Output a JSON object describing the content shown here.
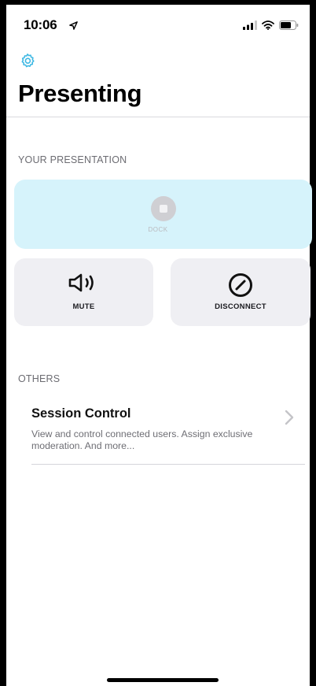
{
  "status_bar": {
    "time": "10:06",
    "location_icon": "location-arrow-icon",
    "signal_icon": "cellular-signal-icon",
    "wifi_icon": "wifi-icon",
    "battery_icon": "battery-icon"
  },
  "header": {
    "settings_icon": "gear-icon",
    "title": "Presenting"
  },
  "your_presentation": {
    "section_label": "YOUR PRESENTATION",
    "dock": {
      "label": "DOCK",
      "icon": "stop-icon",
      "background": "#d6f3fb"
    },
    "mute": {
      "label": "MUTE",
      "icon": "speaker-icon"
    },
    "disconnect": {
      "label": "DISCONNECT",
      "icon": "prohibited-icon"
    }
  },
  "others": {
    "section_label": "OTHERS",
    "items": [
      {
        "title": "Session Control",
        "description": "View and control connected users. Assign exclusive moderation. And more...",
        "icon": "chevron-right-icon"
      }
    ]
  },
  "colors": {
    "accent": "#3fb8e3",
    "card_bg": "#efeff3",
    "dock_bg": "#d6f3fb",
    "secondary_text": "#6c6c72"
  }
}
